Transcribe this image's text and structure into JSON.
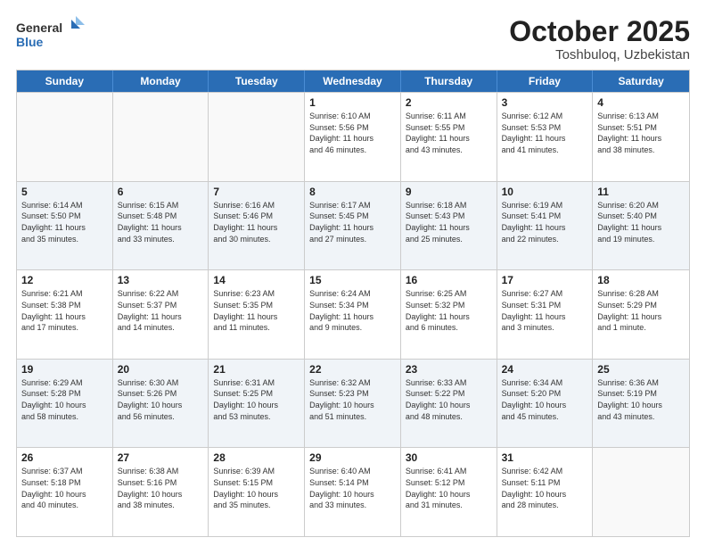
{
  "header": {
    "logo_line1": "General",
    "logo_line2": "Blue",
    "month": "October 2025",
    "location": "Toshbuloq, Uzbekistan"
  },
  "days_of_week": [
    "Sunday",
    "Monday",
    "Tuesday",
    "Wednesday",
    "Thursday",
    "Friday",
    "Saturday"
  ],
  "rows": [
    [
      {
        "day": "",
        "info": ""
      },
      {
        "day": "",
        "info": ""
      },
      {
        "day": "",
        "info": ""
      },
      {
        "day": "1",
        "info": "Sunrise: 6:10 AM\nSunset: 5:56 PM\nDaylight: 11 hours\nand 46 minutes."
      },
      {
        "day": "2",
        "info": "Sunrise: 6:11 AM\nSunset: 5:55 PM\nDaylight: 11 hours\nand 43 minutes."
      },
      {
        "day": "3",
        "info": "Sunrise: 6:12 AM\nSunset: 5:53 PM\nDaylight: 11 hours\nand 41 minutes."
      },
      {
        "day": "4",
        "info": "Sunrise: 6:13 AM\nSunset: 5:51 PM\nDaylight: 11 hours\nand 38 minutes."
      }
    ],
    [
      {
        "day": "5",
        "info": "Sunrise: 6:14 AM\nSunset: 5:50 PM\nDaylight: 11 hours\nand 35 minutes."
      },
      {
        "day": "6",
        "info": "Sunrise: 6:15 AM\nSunset: 5:48 PM\nDaylight: 11 hours\nand 33 minutes."
      },
      {
        "day": "7",
        "info": "Sunrise: 6:16 AM\nSunset: 5:46 PM\nDaylight: 11 hours\nand 30 minutes."
      },
      {
        "day": "8",
        "info": "Sunrise: 6:17 AM\nSunset: 5:45 PM\nDaylight: 11 hours\nand 27 minutes."
      },
      {
        "day": "9",
        "info": "Sunrise: 6:18 AM\nSunset: 5:43 PM\nDaylight: 11 hours\nand 25 minutes."
      },
      {
        "day": "10",
        "info": "Sunrise: 6:19 AM\nSunset: 5:41 PM\nDaylight: 11 hours\nand 22 minutes."
      },
      {
        "day": "11",
        "info": "Sunrise: 6:20 AM\nSunset: 5:40 PM\nDaylight: 11 hours\nand 19 minutes."
      }
    ],
    [
      {
        "day": "12",
        "info": "Sunrise: 6:21 AM\nSunset: 5:38 PM\nDaylight: 11 hours\nand 17 minutes."
      },
      {
        "day": "13",
        "info": "Sunrise: 6:22 AM\nSunset: 5:37 PM\nDaylight: 11 hours\nand 14 minutes."
      },
      {
        "day": "14",
        "info": "Sunrise: 6:23 AM\nSunset: 5:35 PM\nDaylight: 11 hours\nand 11 minutes."
      },
      {
        "day": "15",
        "info": "Sunrise: 6:24 AM\nSunset: 5:34 PM\nDaylight: 11 hours\nand 9 minutes."
      },
      {
        "day": "16",
        "info": "Sunrise: 6:25 AM\nSunset: 5:32 PM\nDaylight: 11 hours\nand 6 minutes."
      },
      {
        "day": "17",
        "info": "Sunrise: 6:27 AM\nSunset: 5:31 PM\nDaylight: 11 hours\nand 3 minutes."
      },
      {
        "day": "18",
        "info": "Sunrise: 6:28 AM\nSunset: 5:29 PM\nDaylight: 11 hours\nand 1 minute."
      }
    ],
    [
      {
        "day": "19",
        "info": "Sunrise: 6:29 AM\nSunset: 5:28 PM\nDaylight: 10 hours\nand 58 minutes."
      },
      {
        "day": "20",
        "info": "Sunrise: 6:30 AM\nSunset: 5:26 PM\nDaylight: 10 hours\nand 56 minutes."
      },
      {
        "day": "21",
        "info": "Sunrise: 6:31 AM\nSunset: 5:25 PM\nDaylight: 10 hours\nand 53 minutes."
      },
      {
        "day": "22",
        "info": "Sunrise: 6:32 AM\nSunset: 5:23 PM\nDaylight: 10 hours\nand 51 minutes."
      },
      {
        "day": "23",
        "info": "Sunrise: 6:33 AM\nSunset: 5:22 PM\nDaylight: 10 hours\nand 48 minutes."
      },
      {
        "day": "24",
        "info": "Sunrise: 6:34 AM\nSunset: 5:20 PM\nDaylight: 10 hours\nand 45 minutes."
      },
      {
        "day": "25",
        "info": "Sunrise: 6:36 AM\nSunset: 5:19 PM\nDaylight: 10 hours\nand 43 minutes."
      }
    ],
    [
      {
        "day": "26",
        "info": "Sunrise: 6:37 AM\nSunset: 5:18 PM\nDaylight: 10 hours\nand 40 minutes."
      },
      {
        "day": "27",
        "info": "Sunrise: 6:38 AM\nSunset: 5:16 PM\nDaylight: 10 hours\nand 38 minutes."
      },
      {
        "day": "28",
        "info": "Sunrise: 6:39 AM\nSunset: 5:15 PM\nDaylight: 10 hours\nand 35 minutes."
      },
      {
        "day": "29",
        "info": "Sunrise: 6:40 AM\nSunset: 5:14 PM\nDaylight: 10 hours\nand 33 minutes."
      },
      {
        "day": "30",
        "info": "Sunrise: 6:41 AM\nSunset: 5:12 PM\nDaylight: 10 hours\nand 31 minutes."
      },
      {
        "day": "31",
        "info": "Sunrise: 6:42 AM\nSunset: 5:11 PM\nDaylight: 10 hours\nand 28 minutes."
      },
      {
        "day": "",
        "info": ""
      }
    ]
  ]
}
